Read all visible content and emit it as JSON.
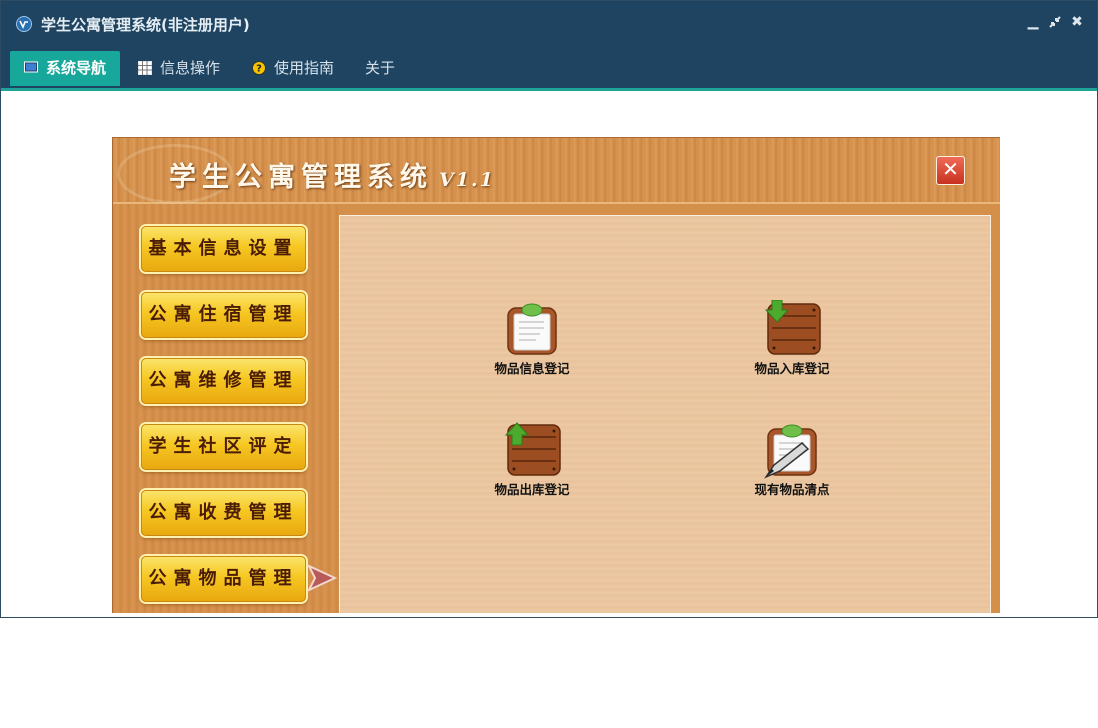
{
  "window": {
    "title": "学生公寓管理系统(非注册用户)",
    "controls": [
      "minimize-icon",
      "restore-icon",
      "close-icon"
    ]
  },
  "tabs": [
    {
      "label": "系统导航",
      "icon": "monitor-icon",
      "active": true
    },
    {
      "label": "信息操作",
      "icon": "grid-icon",
      "active": false
    },
    {
      "label": "使用指南",
      "icon": "help-icon",
      "active": false
    },
    {
      "label": "关于",
      "icon": "",
      "active": false
    }
  ],
  "app": {
    "title": "学生公寓管理系统",
    "version": "V1.1",
    "close_label": "✕"
  },
  "sidebar": {
    "items": [
      {
        "label": "基本信息设置"
      },
      {
        "label": "公寓住宿管理"
      },
      {
        "label": "公寓维修管理"
      },
      {
        "label": "学生社区评定"
      },
      {
        "label": "公寓收费管理"
      },
      {
        "label": "公寓物品管理",
        "active": true
      }
    ]
  },
  "panel": {
    "items": [
      {
        "label": "物品信息登记",
        "icon": "clipboard-icon"
      },
      {
        "label": "物品入库登记",
        "icon": "crate-in-icon"
      },
      {
        "label": "物品出库登记",
        "icon": "crate-out-icon"
      },
      {
        "label": "现有物品清点",
        "icon": "clipboard-pen-icon"
      }
    ]
  },
  "colors": {
    "titlebar": "#1e4461",
    "tab_active": "#17a79b",
    "wood": "#d4904a",
    "button": "#f6c722"
  }
}
